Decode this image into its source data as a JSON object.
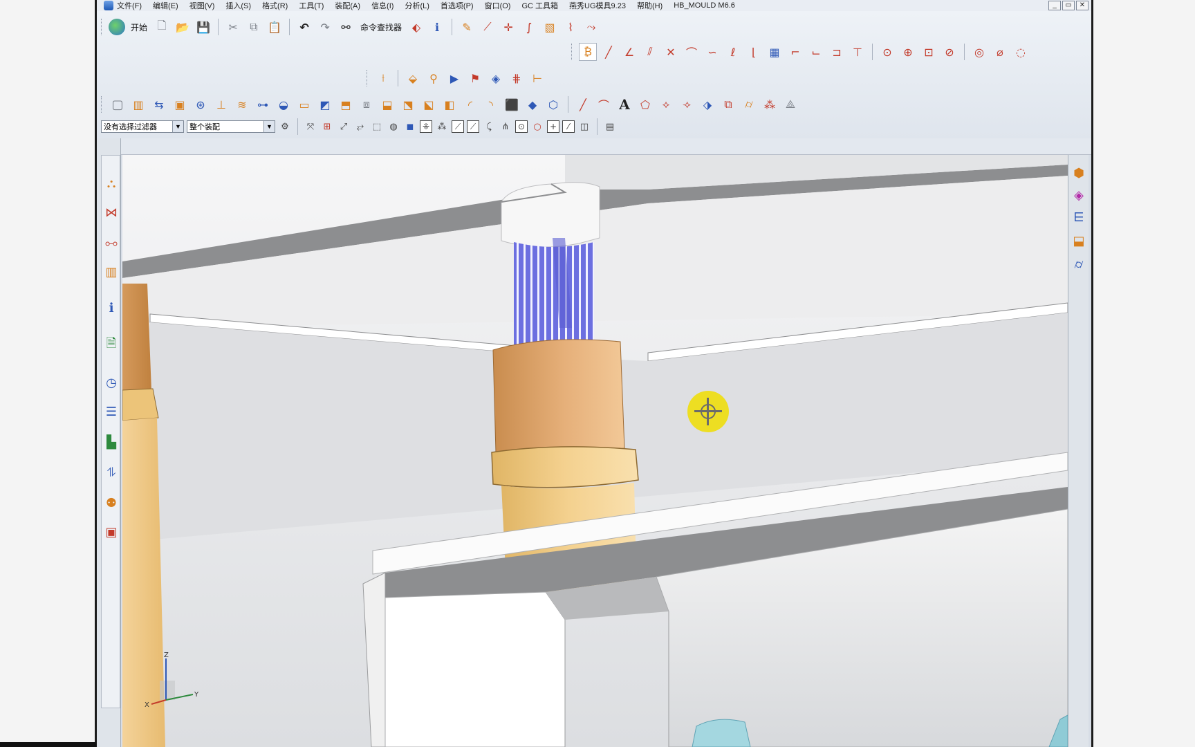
{
  "app": {
    "menu": [
      "文件(F)",
      "编辑(E)",
      "视图(V)",
      "插入(S)",
      "格式(R)",
      "工具(T)",
      "装配(A)",
      "信息(I)",
      "分析(L)",
      "首选项(P)",
      "窗口(O)",
      "GC 工具箱",
      "燕秀UG模具9.23",
      "帮助(H)",
      "HB_MOULD M6.6"
    ],
    "window_controls": [
      "_",
      "▭",
      "✕"
    ]
  },
  "toolbar": {
    "start_label": "开始",
    "command_finder_label": "命令查找器"
  },
  "filters": {
    "type_filter": "没有选择过滤器",
    "scope_filter": "整个装配"
  },
  "icons": {
    "start": "siemens-logo-icon",
    "new": "new-file-icon",
    "open": "open-folder-icon",
    "save": "save-icon",
    "cut": "scissors-icon",
    "copy": "copy-icon",
    "paste": "paste-icon",
    "undo": "undo-icon",
    "redo": "redo-icon",
    "finder": "binoculars-icon"
  },
  "triad": {
    "x": "X",
    "y": "Y",
    "z": "Z"
  },
  "colors": {
    "accent_copper": "#d49b5c",
    "accent_cream": "#f1c980",
    "shaft_blue": "#6366d8",
    "cursor_yellow": "#f0de00"
  }
}
